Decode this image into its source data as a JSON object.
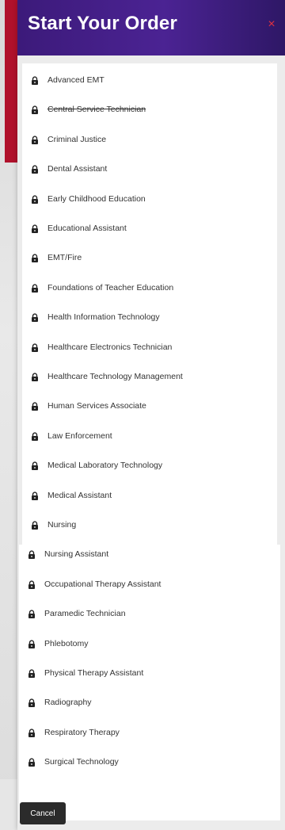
{
  "modal": {
    "title": "Start Your Order",
    "close_label": "×",
    "cancel_label": "Cancel"
  },
  "programs": [
    {
      "label": "Advanced EMT",
      "struck": false
    },
    {
      "label": "Central Service Technician",
      "struck": true
    },
    {
      "label": "Criminal Justice",
      "struck": false
    },
    {
      "label": "Dental Assistant",
      "struck": false
    },
    {
      "label": "Early Childhood Education",
      "struck": false
    },
    {
      "label": "Educational Assistant",
      "struck": false
    },
    {
      "label": "EMT/Fire",
      "struck": false
    },
    {
      "label": "Foundations of Teacher Education",
      "struck": false
    },
    {
      "label": "Health Information Technology",
      "struck": false
    },
    {
      "label": "Healthcare Electronics Technician",
      "struck": false
    },
    {
      "label": "Healthcare Technology Management",
      "struck": false
    },
    {
      "label": "Human Services Associate",
      "struck": false
    },
    {
      "label": "Law Enforcement",
      "struck": false
    },
    {
      "label": "Medical Laboratory Technology",
      "struck": false
    },
    {
      "label": "Medical Assistant",
      "struck": false
    },
    {
      "label": "Nursing",
      "struck": false
    },
    {
      "label": "Nursing Assistant",
      "struck": false
    },
    {
      "label": "Occupational Therapy Assistant",
      "struck": false
    },
    {
      "label": "Paramedic Technician",
      "struck": false
    },
    {
      "label": "Phlebotomy",
      "struck": false
    },
    {
      "label": "Physical Therapy Assistant",
      "struck": false
    },
    {
      "label": "Radiography",
      "struck": false
    },
    {
      "label": "Respiratory Therapy",
      "struck": false
    },
    {
      "label": "Surgical Technology",
      "struck": false
    }
  ],
  "icon": "lock-icon",
  "colors": {
    "header": "#4b2393",
    "close": "#e0313f",
    "accent_red": "#b0112b",
    "button": "#2b2b2b"
  }
}
